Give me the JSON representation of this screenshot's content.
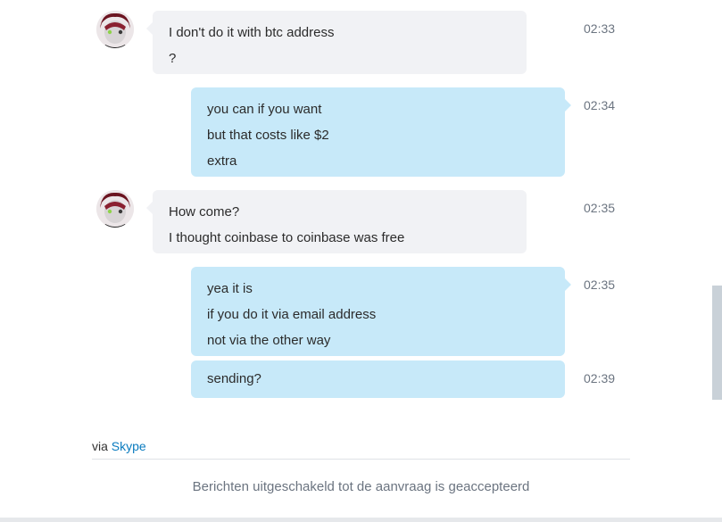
{
  "conversation": {
    "messages": [
      {
        "direction": "incoming",
        "lines": [
          "I don't do it with btc address",
          "?"
        ],
        "time": "02:33"
      },
      {
        "direction": "outgoing",
        "lines": [
          "you can if you want",
          "but that costs like $2",
          "extra"
        ],
        "time": "02:34"
      },
      {
        "direction": "incoming",
        "lines": [
          "How come?",
          "I thought coinbase to coinbase was free"
        ],
        "time": "02:35"
      },
      {
        "direction": "outgoing",
        "lines": [
          "yea it is",
          "if you do it via email address",
          "not via the other way"
        ],
        "time": "02:35"
      },
      {
        "direction": "outgoing",
        "lines": [
          "sending?"
        ],
        "time": "02:39"
      }
    ]
  },
  "footer": {
    "via_prefix": "via ",
    "via_link": "Skype",
    "disabled_notice": "Berichten uitgeschakeld tot de aanvraag is geaccepteerd"
  },
  "colors": {
    "incoming_bubble": "#f1f2f5",
    "outgoing_bubble": "#c7e9f9",
    "link": "#0a7bbf",
    "timestamp": "#6b7480"
  }
}
